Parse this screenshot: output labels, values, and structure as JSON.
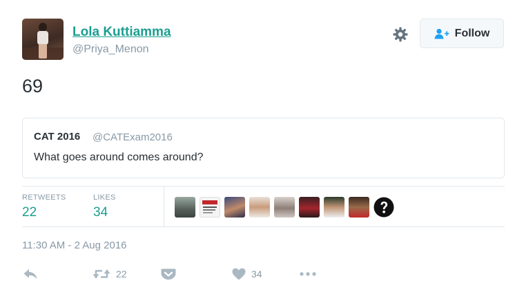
{
  "author": {
    "display_name": "Lola Kuttiamma",
    "handle": "@Priya_Menon"
  },
  "follow_button": {
    "label": "Follow"
  },
  "tweet": {
    "text": "69"
  },
  "quoted_tweet": {
    "name": "CAT 2016",
    "handle": "@CATExam2016",
    "text": "What goes around comes around?"
  },
  "stats": {
    "retweets_label": "RETWEETS",
    "retweets_value": "22",
    "likes_label": "LIKES",
    "likes_value": "34"
  },
  "timestamp": "11:30 AM - 2 Aug 2016",
  "actions": {
    "retweet_count": "22",
    "like_count": "34"
  },
  "icons": {
    "settings": "gear-icon",
    "follow": "add-user-icon",
    "reply": "reply-icon",
    "retweet": "retweet-icon",
    "pocket": "pocket-icon",
    "like": "heart-icon",
    "more": "more-dots-icon",
    "unknown_liker": "question-mark-icon"
  },
  "colors": {
    "accent": "#1b9e8f",
    "muted": "#8899a6",
    "border": "#e1e8ed",
    "text": "#292f33"
  }
}
